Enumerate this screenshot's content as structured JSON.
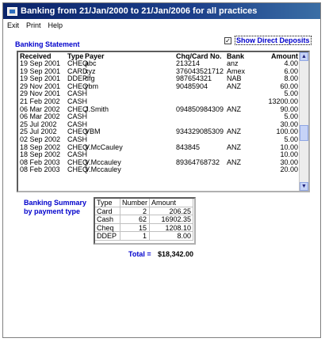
{
  "window": {
    "title": "Banking from 21/Jan/2000 to 21/Jan/2006 for all practices"
  },
  "menu": [
    "Exit",
    "Print",
    "Help"
  ],
  "statement": {
    "label": "Banking Statement",
    "show_direct_deposits": {
      "label": "Show Direct Deposits",
      "checked": true,
      "mark": "✓"
    },
    "columns": [
      "Received",
      "Type",
      "Payer",
      "Chq/Card No.",
      "Bank",
      "Amount"
    ],
    "rows": [
      {
        "received": "19 Sep 2001",
        "type": "CHEQ",
        "payer": "abc",
        "chq": "213214",
        "bank": "anz",
        "amount": "4.00"
      },
      {
        "received": "19 Sep 2001",
        "type": "CARD",
        "payer": "xyz",
        "chq": "376043521712",
        "bank": "Amex",
        "amount": "6.00"
      },
      {
        "received": "19 Sep 2001",
        "type": "DDEP",
        "payer": "dfg",
        "chq": "987654321",
        "bank": "NAB",
        "amount": "8.00"
      },
      {
        "received": "29 Nov 2001",
        "type": "CHEQ",
        "payer": "vbm",
        "chq": "90485904",
        "bank": "ANZ",
        "amount": "60.00"
      },
      {
        "received": "29 Nov 2001",
        "type": "CASH",
        "payer": "",
        "chq": "",
        "bank": "",
        "amount": "5.00"
      },
      {
        "received": "21 Feb 2002",
        "type": "CASH",
        "payer": "",
        "chq": "",
        "bank": "",
        "amount": "13200.00"
      },
      {
        "received": "06 Mar 2002",
        "type": "CHEQ",
        "payer": "J.Smith",
        "chq": "094850984309",
        "bank": "ANZ",
        "amount": "90.00"
      },
      {
        "received": "06 Mar 2002",
        "type": "CASH",
        "payer": "",
        "chq": "",
        "bank": "",
        "amount": "5.00"
      },
      {
        "received": "25 Jul 2002",
        "type": "CASH",
        "payer": "",
        "chq": "",
        "bank": "",
        "amount": "30.00"
      },
      {
        "received": "25 Jul 2002",
        "type": "CHEQ",
        "payer": "VBM",
        "chq": "934329085309",
        "bank": "ANZ",
        "amount": "100.00"
      },
      {
        "received": "02 Sep 2002",
        "type": "CASH",
        "payer": "",
        "chq": "",
        "bank": "",
        "amount": "5.00"
      },
      {
        "received": "18 Sep 2002",
        "type": "CHEQ",
        "payer": "V.McCauley",
        "chq": "843845",
        "bank": "ANZ",
        "amount": "10.00"
      },
      {
        "received": "18 Sep 2002",
        "type": "CASH",
        "payer": "",
        "chq": "",
        "bank": "",
        "amount": "10.00"
      },
      {
        "received": "08 Feb 2003",
        "type": "CHEQ",
        "payer": "V.Mccauley",
        "chq": "89364768732",
        "bank": "ANZ",
        "amount": "30.00"
      },
      {
        "received": "08 Feb 2003",
        "type": "CHEQ",
        "payer": "V.Mccauley",
        "chq": "",
        "bank": "",
        "amount": "20.00"
      }
    ],
    "scroll_up": "▲",
    "scroll_down": "▼"
  },
  "summary": {
    "label": "Banking Summary by payment type",
    "columns": [
      "Type",
      "Number",
      "Amount"
    ],
    "rows": [
      {
        "type": "Card",
        "number": "2",
        "amount": "206.25"
      },
      {
        "type": "Cash",
        "number": "62",
        "amount": "16902.35"
      },
      {
        "type": "Cheq",
        "number": "15",
        "amount": "1208.10"
      },
      {
        "type": "DDEP",
        "number": "1",
        "amount": "8.00"
      }
    ],
    "total_label": "Total =",
    "total_value": "$18,342.00"
  },
  "colors": {
    "title_bar": "#0a246a",
    "label_blue": "#0000cc"
  }
}
